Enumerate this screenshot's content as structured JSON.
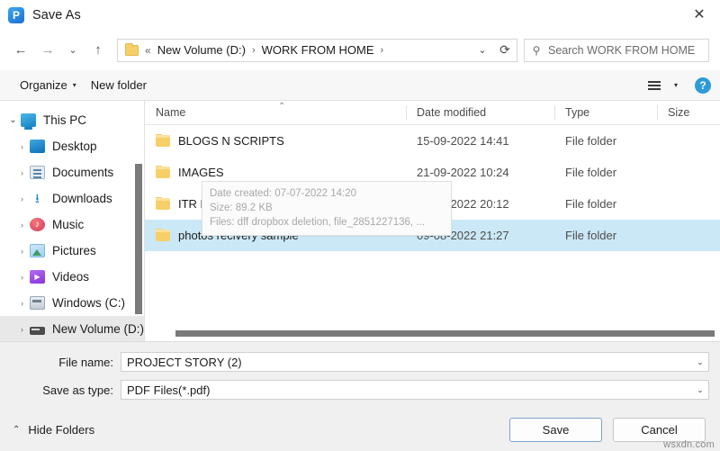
{
  "window": {
    "title": "Save As",
    "app_icon": "pdf-app-icon",
    "app_icon_letter": "P",
    "close_label": "✕"
  },
  "nav": {
    "back": "←",
    "forward": "→",
    "recent": "⌄",
    "up": "↑",
    "address": {
      "folder_icon": "folder-icon",
      "prefix": "«",
      "crumbs": [
        {
          "label": "New Volume (D:)",
          "sep": "›"
        },
        {
          "label": "WORK FROM HOME",
          "sep": "›"
        }
      ],
      "dropdown": "⌄",
      "refresh": "⟳"
    },
    "search": {
      "icon": "search-icon",
      "placeholder": "Search WORK FROM HOME",
      "value": ""
    }
  },
  "command_bar": {
    "organize_label": "Organize",
    "organize_caret": "▾",
    "new_folder_label": "New folder",
    "view_icon": "list-view-icon",
    "view_caret": "▾",
    "help_icon": "help-icon",
    "help_label": "?"
  },
  "tree": {
    "items": [
      {
        "label": "This PC",
        "level": 0,
        "chevron": "⌄",
        "expanded": true,
        "icon": "this-pc-icon",
        "icon_class": "pc",
        "selected": false
      },
      {
        "label": "Desktop",
        "level": 1,
        "chevron": "›",
        "expanded": false,
        "icon": "desktop-icon",
        "icon_class": "desktop",
        "selected": false
      },
      {
        "label": "Documents",
        "level": 1,
        "chevron": "›",
        "expanded": false,
        "icon": "documents-icon",
        "icon_class": "docs",
        "selected": false
      },
      {
        "label": "Downloads",
        "level": 1,
        "chevron": "›",
        "expanded": false,
        "icon": "downloads-icon",
        "icon_class": "dl",
        "selected": false
      },
      {
        "label": "Music",
        "level": 1,
        "chevron": "›",
        "expanded": false,
        "icon": "music-icon",
        "icon_class": "music",
        "selected": false
      },
      {
        "label": "Pictures",
        "level": 1,
        "chevron": "›",
        "expanded": false,
        "icon": "pictures-icon",
        "icon_class": "pics",
        "selected": false
      },
      {
        "label": "Videos",
        "level": 1,
        "chevron": "›",
        "expanded": false,
        "icon": "videos-icon",
        "icon_class": "videos",
        "selected": false
      },
      {
        "label": "Windows (C:)",
        "level": 1,
        "chevron": "›",
        "expanded": false,
        "icon": "drive-c-icon",
        "icon_class": "drive",
        "selected": false
      },
      {
        "label": "New Volume (D:)",
        "level": 1,
        "chevron": "›",
        "expanded": false,
        "icon": "drive-d-icon",
        "icon_class": "hdd",
        "selected": true
      }
    ]
  },
  "file_list": {
    "columns": [
      {
        "key": "name",
        "label": "Name",
        "sorted": true,
        "sort_caret": "⌃"
      },
      {
        "key": "date",
        "label": "Date modified",
        "sorted": false,
        "sort_caret": ""
      },
      {
        "key": "type",
        "label": "Type",
        "sorted": false,
        "sort_caret": ""
      },
      {
        "key": "size",
        "label": "Size",
        "sorted": false,
        "sort_caret": ""
      }
    ],
    "rows": [
      {
        "name": "BLOGS N SCRIPTS",
        "date": "15-09-2022 14:41",
        "type": "File folder",
        "size": "",
        "selected": false
      },
      {
        "name": "IMAGES",
        "date": "21-09-2022 10:24",
        "type": "File folder",
        "size": "",
        "selected": false
      },
      {
        "name": "ITR Declaration",
        "date": "29-06-2022 20:12",
        "type": "File folder",
        "size": "",
        "selected": false
      },
      {
        "name": "photos recivery sample",
        "date": "09-08-2022 21:27",
        "type": "File folder",
        "size": "",
        "selected": true
      }
    ],
    "tooltip": {
      "line1": "Date created: 07-07-2022 14:20",
      "line2": "Size: 89.2 KB",
      "line3": "Files: dff dropbox deletion, file_2851227136, ..."
    }
  },
  "form": {
    "file_name_label": "File name:",
    "file_name_value": "PROJECT STORY (2)",
    "save_as_type_label": "Save as type:",
    "save_as_type_value": "PDF Files(*.pdf)",
    "dropdown_caret": "⌄"
  },
  "footer": {
    "hide_folders_caret": "⌃",
    "hide_folders_label": "Hide Folders",
    "save_label": "Save",
    "cancel_label": "Cancel",
    "watermark": "wsxdn.com"
  },
  "colors": {
    "selection_blue": "#cbe8f6",
    "accent_blue": "#2f9bd6",
    "folder_yellow": "#f7cf68",
    "tree_selected_gray": "#e8e8e8"
  }
}
